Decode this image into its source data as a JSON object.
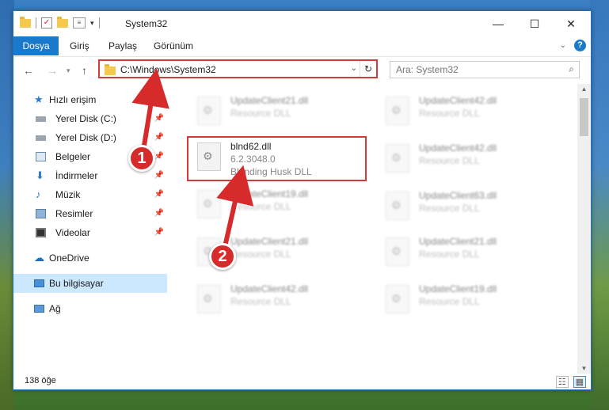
{
  "window": {
    "title": "System32"
  },
  "ribbon": {
    "file_tab": "Dosya",
    "tabs": [
      "Giriş",
      "Paylaş",
      "Görünüm"
    ],
    "help": "?"
  },
  "nav": {
    "address": "C:\\Windows\\System32",
    "search_placeholder": "Ara: System32"
  },
  "sidebar": {
    "quick_access": "Hızlı erişim",
    "items": [
      {
        "label": "Yerel Disk (C:)",
        "icon": "drive-icon"
      },
      {
        "label": "Yerel Disk (D:)",
        "icon": "drive-icon"
      },
      {
        "label": "Belgeler",
        "icon": "documents-icon"
      },
      {
        "label": "İndirmeler",
        "icon": "download-icon"
      },
      {
        "label": "Müzik",
        "icon": "music-icon"
      },
      {
        "label": "Resimler",
        "icon": "pictures-icon"
      },
      {
        "label": "Videolar",
        "icon": "videos-icon"
      }
    ],
    "onedrive": "OneDrive",
    "this_pc": "Bu bilgisayar",
    "network": "Ağ"
  },
  "files": {
    "left": [
      {
        "name": "UpdateClient21.dll",
        "type": "Resource DLL"
      },
      {
        "name": "blnd62.dll",
        "version": "6.2.3048.0",
        "desc": "Blending Husk DLL"
      },
      {
        "name": "UpdateClient19.dll",
        "type": "Resource DLL"
      },
      {
        "name": "UpdateClient21.dll",
        "type": "Resource DLL"
      },
      {
        "name": "UpdateClient42.dll",
        "type": "Resource DLL"
      }
    ],
    "right": [
      {
        "name": "UpdateClient42.dll",
        "type": "Resource DLL"
      },
      {
        "name": "UpdateClient42.dll",
        "type": "Resource DLL"
      },
      {
        "name": "UpdateClient63.dll",
        "type": "Resource DLL"
      },
      {
        "name": "UpdateClient21.dll",
        "type": "Resource DLL"
      },
      {
        "name": "UpdateClient19.dll",
        "type": "Resource DLL"
      }
    ]
  },
  "status": {
    "count": "138 öğe"
  },
  "annotations": {
    "step1": "1",
    "step2": "2"
  },
  "colors": {
    "accent": "#1979ca",
    "highlight": "#d33a3a",
    "selected": "#cce8ff"
  }
}
